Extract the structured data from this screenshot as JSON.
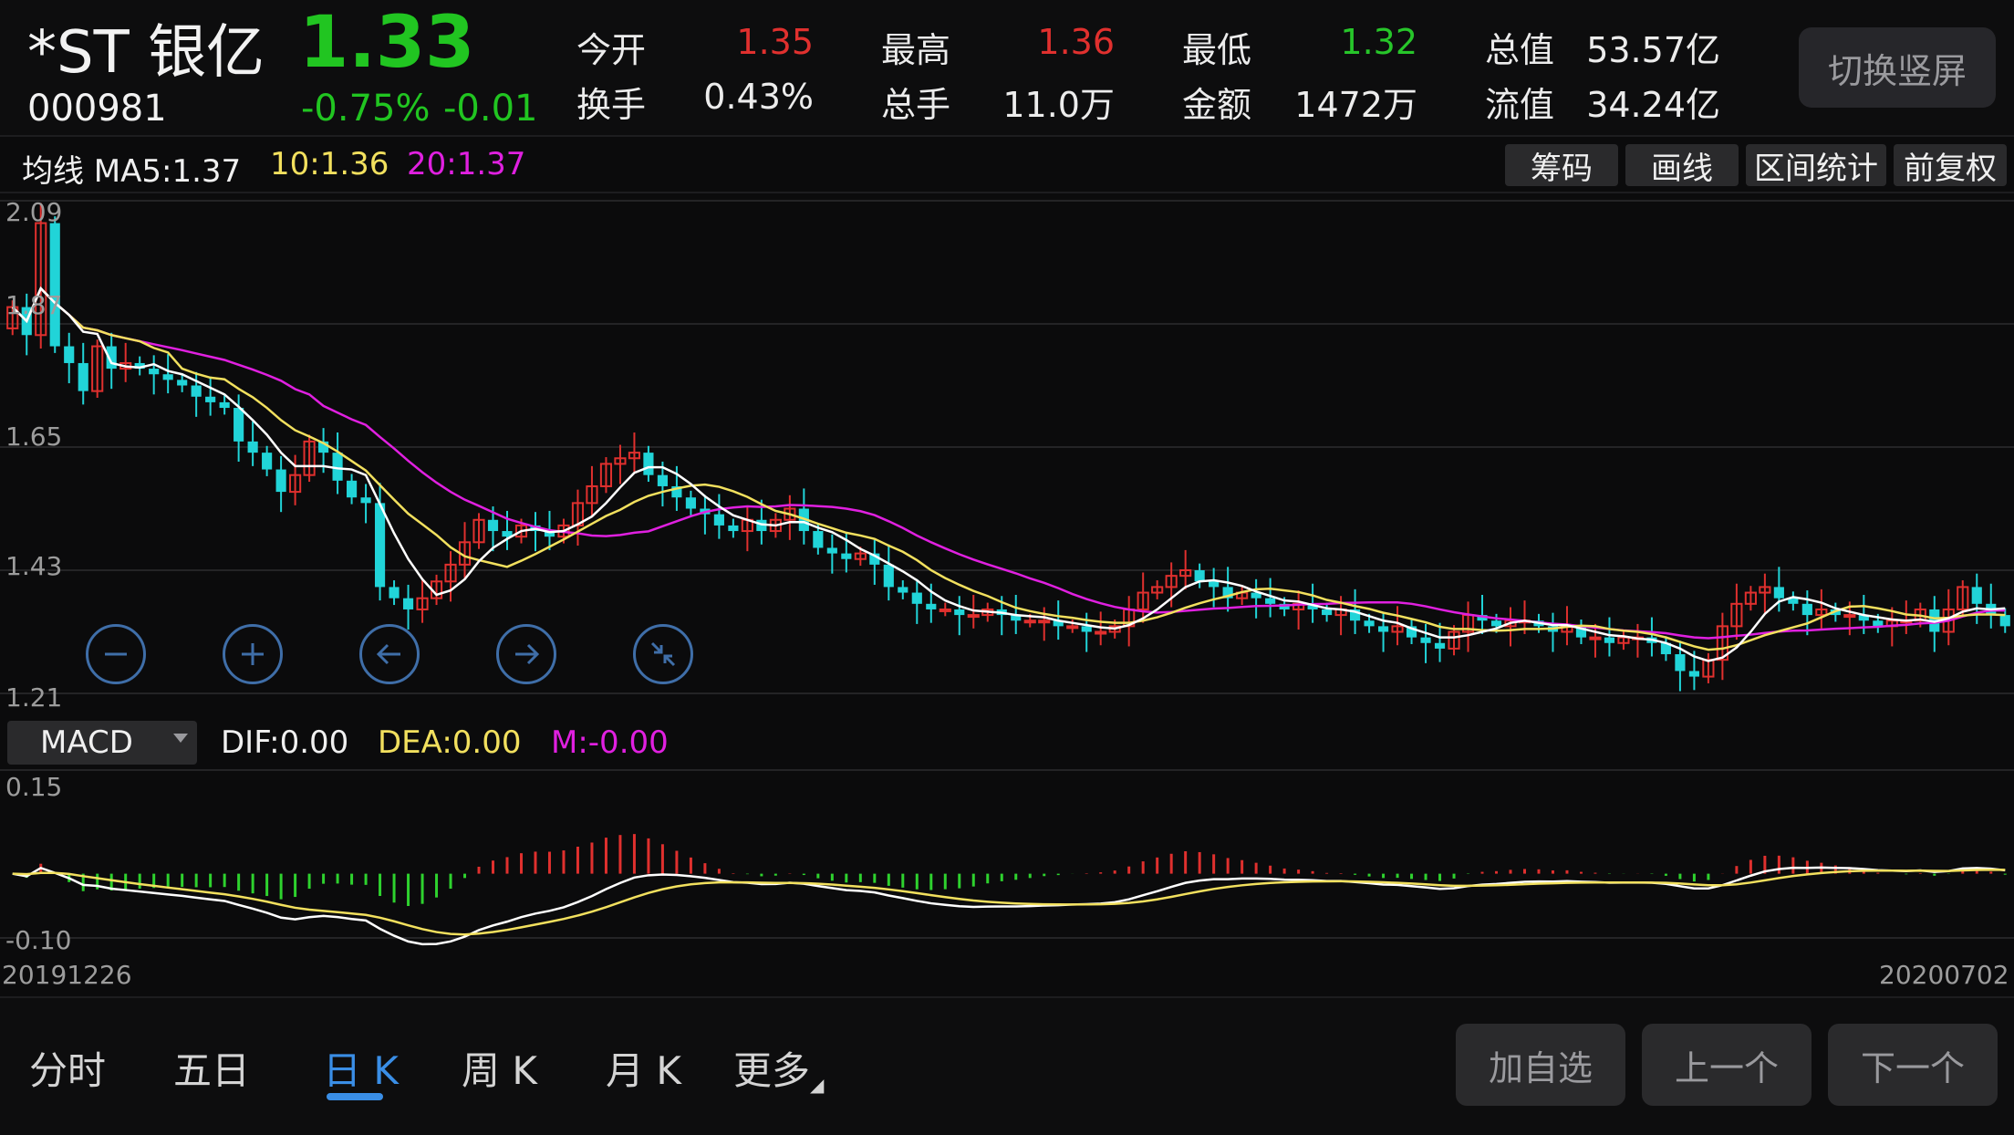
{
  "stock": {
    "name": "*ST 银亿",
    "code": "000981",
    "price": "1.33",
    "change_pct": "-0.75%",
    "change_abs": "-0.01"
  },
  "quote": {
    "open_label": "今开",
    "open": "1.35",
    "high_label": "最高",
    "high": "1.36",
    "low_label": "最低",
    "low": "1.32",
    "mktcap_label": "总值",
    "mktcap": "53.57亿",
    "turnover_label": "换手",
    "turnover": "0.43%",
    "volume_label": "总手",
    "volume": "11.0万",
    "amount_label": "金额",
    "amount": "1472万",
    "float_label": "流值",
    "float": "34.24亿"
  },
  "switch_label": "切换竖屏",
  "ma": {
    "label": "均线 MA5:1.37",
    "ma10": "10:1.36",
    "ma20": "20:1.37"
  },
  "tools": [
    "筹码",
    "画线",
    "区间统计",
    "前复权"
  ],
  "price_axis": [
    "2.09",
    "1.87",
    "1.65",
    "1.43",
    "1.21"
  ],
  "macd": {
    "selector": "MACD",
    "dif": "DIF:0.00",
    "dea": "DEA:0.00",
    "m": "M:-0.00",
    "axis_top": "0.15",
    "axis_bottom": "-0.10"
  },
  "dates": {
    "start": "20191226",
    "end": "20200702"
  },
  "tabs": [
    "分时",
    "五日",
    "日 K",
    "周 K",
    "月 K",
    "更多"
  ],
  "active_tab": "日 K",
  "buttons": {
    "add": "加自选",
    "prev": "上一个",
    "next": "下一个"
  },
  "colors": {
    "up": "#e0302e",
    "down": "#21d4d8",
    "ma5": "#ffffff",
    "ma10": "#f2e05e",
    "ma20": "#e020e0",
    "macd_green": "#2ed22e"
  },
  "chart_data": {
    "type": "candlestick",
    "ylim": [
      1.21,
      2.09
    ],
    "price_ticks": [
      "2.09",
      "1.87",
      "1.65",
      "1.43",
      "1.21"
    ],
    "closes": [
      1.9,
      1.85,
      2.05,
      1.83,
      1.8,
      1.75,
      1.83,
      1.79,
      1.8,
      1.79,
      1.78,
      1.77,
      1.76,
      1.74,
      1.73,
      1.72,
      1.66,
      1.64,
      1.61,
      1.57,
      1.6,
      1.66,
      1.64,
      1.59,
      1.56,
      1.55,
      1.4,
      1.38,
      1.36,
      1.38,
      1.41,
      1.44,
      1.48,
      1.52,
      1.5,
      1.49,
      1.51,
      1.5,
      1.49,
      1.51,
      1.55,
      1.58,
      1.62,
      1.63,
      1.64,
      1.6,
      1.58,
      1.56,
      1.54,
      1.53,
      1.51,
      1.5,
      1.52,
      1.5,
      1.52,
      1.54,
      1.5,
      1.47,
      1.46,
      1.45,
      1.46,
      1.44,
      1.4,
      1.39,
      1.37,
      1.36,
      1.36,
      1.35,
      1.35,
      1.36,
      1.35,
      1.34,
      1.34,
      1.34,
      1.33,
      1.33,
      1.32,
      1.32,
      1.33,
      1.36,
      1.39,
      1.4,
      1.42,
      1.43,
      1.41,
      1.4,
      1.38,
      1.39,
      1.38,
      1.37,
      1.36,
      1.37,
      1.36,
      1.35,
      1.36,
      1.34,
      1.33,
      1.32,
      1.33,
      1.31,
      1.3,
      1.29,
      1.32,
      1.35,
      1.34,
      1.33,
      1.34,
      1.34,
      1.33,
      1.32,
      1.33,
      1.31,
      1.31,
      1.3,
      1.31,
      1.31,
      1.3,
      1.28,
      1.25,
      1.24,
      1.27,
      1.33,
      1.37,
      1.39,
      1.4,
      1.38,
      1.37,
      1.35,
      1.36,
      1.35,
      1.35,
      1.34,
      1.33,
      1.34,
      1.34,
      1.36,
      1.32,
      1.36,
      1.4,
      1.37,
      1.35,
      1.33
    ]
  }
}
